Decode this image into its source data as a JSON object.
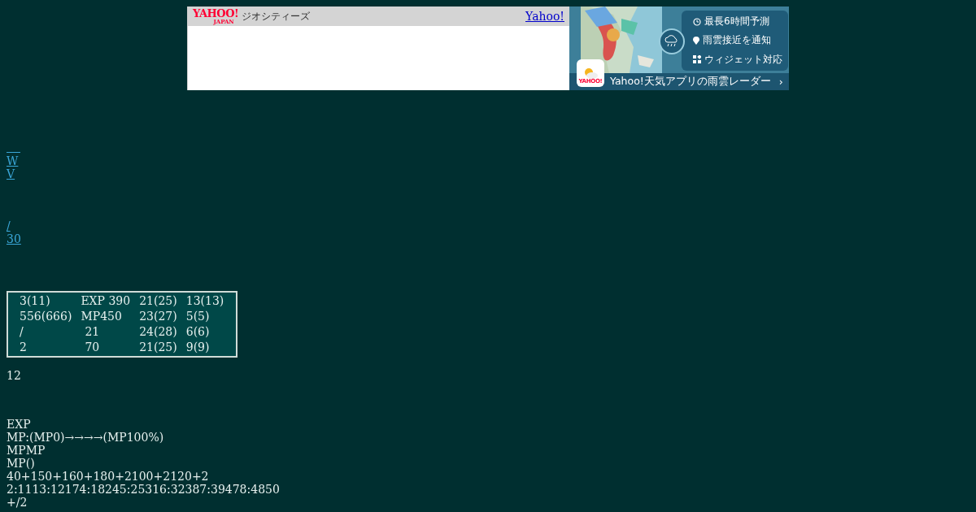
{
  "ad": {
    "logo_main": "YAHOO!",
    "logo_sub": "JAPAN",
    "service": "ジオシティーズ",
    "link": "Yahoo!",
    "features": [
      "最長6時間予測",
      "雨雲接近を通知",
      "ウィジェット対応"
    ],
    "app_icon_text": "YAHOO!",
    "banner_title": "Yahoo!天気アプリの雨雲レーダー",
    "banner_arrow": "›"
  },
  "nav_links": [
    {
      "label": "W"
    },
    {
      "label": "V"
    }
  ],
  "page_links": [
    {
      "label": "/"
    },
    {
      "label": "30"
    }
  ],
  "stats_table": {
    "rows": [
      [
        "3(11)",
        "EXP 390",
        "21(25)",
        "13(13)"
      ],
      [
        "556(666)",
        "MP450",
        "23(27)",
        "5(5)"
      ],
      [
        "/",
        "21",
        "24(28)",
        "6(6)"
      ],
      [
        "2",
        "70",
        "21(25)",
        "9(9)"
      ]
    ]
  },
  "count": "12",
  "notes": [
    "EXP",
    "MP:(MP0)→→→→(MP100%)",
    "MPMP",
    "MP()",
    "40+150+160+180+2100+2120+2",
    "2:1113:12174:18245:25316:32387:39478:4850",
    "+/2"
  ]
}
